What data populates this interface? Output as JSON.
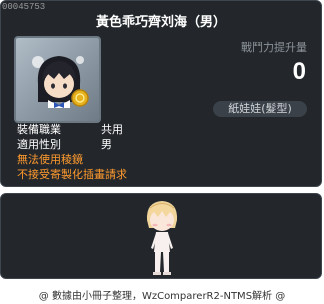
{
  "item_id": "00045753",
  "title": "黃色乖巧齊刘海（男）",
  "power": {
    "label": "戰鬥力提升量",
    "value": "0"
  },
  "category": "紙娃娃(髮型)",
  "info": {
    "job_key": "裝備職業",
    "job_value": "共用",
    "gender_key": "適用性別",
    "gender_value": "男",
    "warn1": "無法使用稜鏡",
    "warn2": "不接受寄製化插畫請求"
  },
  "credit": "@ 數據由小冊子整理，WzComparerR2-NTMS解析 @",
  "icons": {
    "item": "hair-item-icon",
    "avatar": "character-avatar-icon"
  },
  "colors": {
    "panel": "#23272c",
    "warning": "#ff9a2c",
    "power_label": "#8c939a"
  }
}
